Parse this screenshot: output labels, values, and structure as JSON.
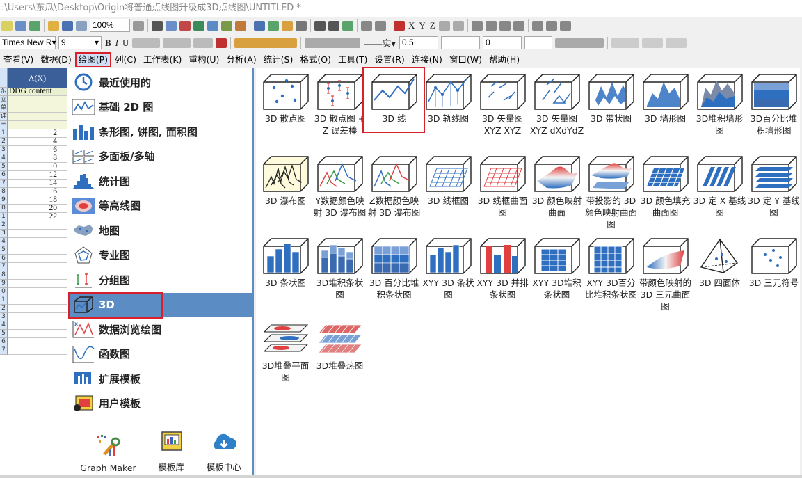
{
  "window": {
    "title": ":\\Users\\东瓜\\Desktop\\Origin将普通点线图升级成3D点线图\\UNTITLED *"
  },
  "toolbar": {
    "zoom": "100%",
    "font_name": "Times New R",
    "font_size": "9",
    "line_style": "实",
    "line_width": "0.5",
    "size_value": "0",
    "axis_labels": [
      "X",
      "Y",
      "Z"
    ]
  },
  "menu": {
    "items": [
      {
        "label": "查看(V)"
      },
      {
        "label": "数据(D)"
      },
      {
        "label": "绘图(P)",
        "active": true
      },
      {
        "label": "列(C)"
      },
      {
        "label": "工作表(K)"
      },
      {
        "label": "重构(U)"
      },
      {
        "label": "分析(A)"
      },
      {
        "label": "统计(S)"
      },
      {
        "label": "格式(O)"
      },
      {
        "label": "工具(T)"
      },
      {
        "label": "设置(R)"
      },
      {
        "label": "连接(N)"
      },
      {
        "label": "窗口(W)"
      },
      {
        "label": "帮助(H)"
      }
    ]
  },
  "sheet": {
    "column_header": "A(X)",
    "meta_rows": [
      {
        "rownum": "东",
        "value": "DDG content"
      },
      {
        "rownum": "立",
        "value": ""
      },
      {
        "rownum": "单",
        "value": ""
      },
      {
        "rownum": "详",
        "value": ""
      },
      {
        "rownum": "=",
        "value": ""
      }
    ],
    "rows": [
      {
        "rownum": "1",
        "value": "2"
      },
      {
        "rownum": "2",
        "value": "4"
      },
      {
        "rownum": "3",
        "value": "6"
      },
      {
        "rownum": "4",
        "value": "8"
      },
      {
        "rownum": "5",
        "value": "10"
      },
      {
        "rownum": "6",
        "value": "12"
      },
      {
        "rownum": "7",
        "value": "14"
      },
      {
        "rownum": "8",
        "value": "16"
      },
      {
        "rownum": "9",
        "value": "18"
      },
      {
        "rownum": "0",
        "value": "20"
      },
      {
        "rownum": "1",
        "value": "22"
      },
      {
        "rownum": "2",
        "value": ""
      },
      {
        "rownum": "3",
        "value": ""
      },
      {
        "rownum": "4",
        "value": ""
      },
      {
        "rownum": "5",
        "value": ""
      },
      {
        "rownum": "6",
        "value": ""
      },
      {
        "rownum": "7",
        "value": ""
      },
      {
        "rownum": "8",
        "value": ""
      },
      {
        "rownum": "9",
        "value": ""
      },
      {
        "rownum": "0",
        "value": ""
      },
      {
        "rownum": "1",
        "value": ""
      },
      {
        "rownum": "2",
        "value": ""
      },
      {
        "rownum": "3",
        "value": ""
      },
      {
        "rownum": "4",
        "value": ""
      },
      {
        "rownum": "5",
        "value": ""
      },
      {
        "rownum": "6",
        "value": ""
      },
      {
        "rownum": "7",
        "value": ""
      }
    ]
  },
  "categories": [
    {
      "label": "最近使用的",
      "icon": "clock-icon"
    },
    {
      "label": "基础 2D 图",
      "icon": "line-chart-icon"
    },
    {
      "label": "条形图, 饼图, 面积图",
      "icon": "bar-chart-icon"
    },
    {
      "label": "多面板/多轴",
      "icon": "multi-panel-icon"
    },
    {
      "label": "统计图",
      "icon": "histogram-icon"
    },
    {
      "label": "等高线图",
      "icon": "contour-icon"
    },
    {
      "label": "地图",
      "icon": "map-icon"
    },
    {
      "label": "专业图",
      "icon": "radar-icon"
    },
    {
      "label": "分组图",
      "icon": "grouped-icon"
    },
    {
      "label": "3D",
      "icon": "cube-icon",
      "selected": true
    },
    {
      "label": "数据浏览绘图",
      "icon": "data-explore-icon"
    },
    {
      "label": "函数图",
      "icon": "function-icon"
    },
    {
      "label": "扩展模板",
      "icon": "extension-icon"
    },
    {
      "label": "用户模板",
      "icon": "user-template-icon"
    }
  ],
  "bottom_tools": [
    {
      "label": "Graph Maker",
      "icon": "graph-maker-icon"
    },
    {
      "label": "模板库",
      "icon": "template-library-icon"
    },
    {
      "label": "模板中心",
      "icon": "cloud-download-icon"
    }
  ],
  "gallery": [
    {
      "label": "3D 散点图",
      "icon": "scatter-3d"
    },
    {
      "label": "3D 散点图 + Z 误差棒",
      "icon": "scatter-3d-errorbar"
    },
    {
      "label": "3D 线",
      "icon": "line-3d",
      "selected": true
    },
    {
      "label": "3D 轨线图",
      "icon": "trajectory-3d"
    },
    {
      "label": "3D 矢量图 XYZ XYZ",
      "icon": "vector-3d"
    },
    {
      "label": "3D 矢量图 XYZ dXdYdZ",
      "icon": "vector-3d-d"
    },
    {
      "label": "3D 带状图",
      "icon": "ribbon-3d"
    },
    {
      "label": "3D 墙形图",
      "icon": "wall-3d"
    },
    {
      "label": "3D堆积墙形图",
      "icon": "stacked-wall-3d"
    },
    {
      "label": "3D百分比堆积墙形图",
      "icon": "percent-wall-3d"
    },
    {
      "label": "3D 瀑布图",
      "icon": "waterfall-3d"
    },
    {
      "label": "Y数据颜色映射 3D 瀑布图",
      "icon": "waterfall-y-color"
    },
    {
      "label": "Z数据颜色映射 3D 瀑布图",
      "icon": "waterfall-z-color"
    },
    {
      "label": "3D 线框图",
      "icon": "wireframe-3d"
    },
    {
      "label": "3D 线框曲面图",
      "icon": "wireframe-surface-3d"
    },
    {
      "label": "3D 颜色映射曲面",
      "icon": "colormap-surface-3d"
    },
    {
      "label": "带投影的 3D 颜色映射曲面图",
      "icon": "projection-surface-3d"
    },
    {
      "label": "3D 颜色填充曲面图",
      "icon": "colorfill-surface-3d"
    },
    {
      "label": "3D 定 X 基线图",
      "icon": "x-base-3d"
    },
    {
      "label": "3D 定 Y 基线图",
      "icon": "y-base-3d"
    },
    {
      "label": "3D 条状图",
      "icon": "bar-3d"
    },
    {
      "label": "3D堆积条状图",
      "icon": "stacked-bar-3d"
    },
    {
      "label": "3D 百分比堆积条状图",
      "icon": "percent-bar-3d"
    },
    {
      "label": "XYY 3D 条状图",
      "icon": "xyy-bar-3d"
    },
    {
      "label": "XYY 3D 并排条状图",
      "icon": "xyy-side-bar-3d"
    },
    {
      "label": "XYY 3D堆积条状图",
      "icon": "xyy-stacked-bar-3d"
    },
    {
      "label": "XYY 3D百分比堆积条状图",
      "icon": "xyy-percent-bar-3d"
    },
    {
      "label": "带颜色映射的 3D 三元曲面图",
      "icon": "ternary-surface-3d"
    },
    {
      "label": "3D 四面体",
      "icon": "tetrahedron-3d"
    },
    {
      "label": "3D 三元符号",
      "icon": "ternary-symbol-3d"
    },
    {
      "label": "3D堆叠平面图",
      "icon": "stacked-plane-3d"
    },
    {
      "label": "3D堆叠热图",
      "icon": "stacked-heatmap-3d"
    }
  ]
}
